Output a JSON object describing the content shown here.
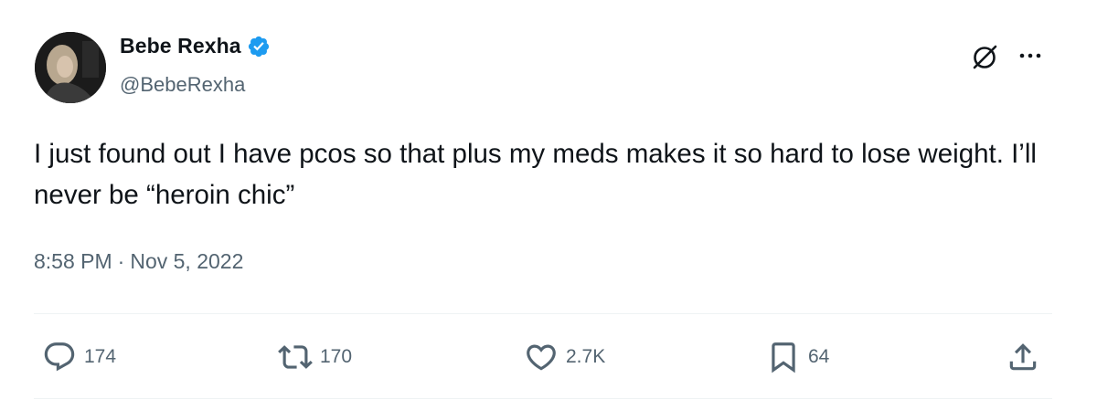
{
  "author": {
    "display_name": "Bebe Rexha",
    "handle": "@BebeRexha",
    "verified": true,
    "verified_color": "#1d9bf0"
  },
  "tweet": {
    "text": "I just found out I have pcos so that plus my meds makes it so hard to lose weight. I’ll never be “heroin chic”",
    "time": "8:58 PM",
    "separator": "·",
    "date": "Nov 5, 2022"
  },
  "actions": {
    "reply_count": "174",
    "retweet_count": "170",
    "like_count": "2.7K",
    "bookmark_count": "64"
  },
  "icons": {
    "header": [
      "grok-icon",
      "more-options-icon"
    ],
    "actions": [
      "reply-icon",
      "retweet-icon",
      "like-icon",
      "bookmark-icon",
      "share-icon"
    ]
  },
  "colors": {
    "text_primary": "#0f1419",
    "text_secondary": "#536471",
    "divider": "#eff3f4"
  }
}
